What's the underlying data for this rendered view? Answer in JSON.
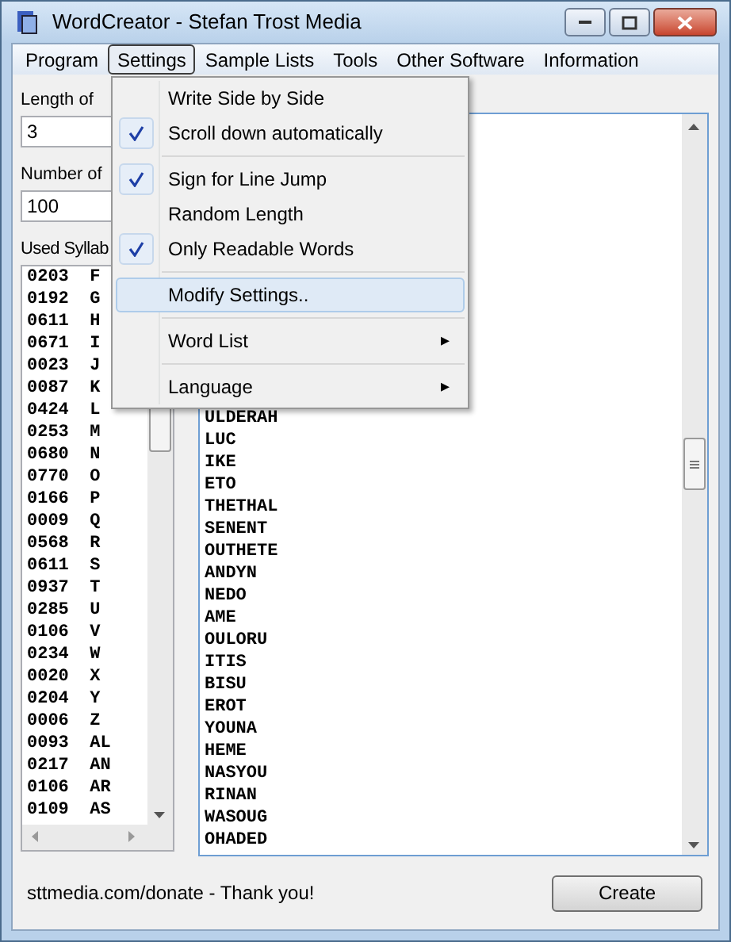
{
  "window": {
    "title": "WordCreator - Stefan Trost Media"
  },
  "menu_bar": [
    {
      "label": "Program",
      "selected": false
    },
    {
      "label": "Settings",
      "selected": true
    },
    {
      "label": "Sample Lists",
      "selected": false
    },
    {
      "label": "Tools",
      "selected": false
    },
    {
      "label": "Other Software",
      "selected": false
    },
    {
      "label": "Information",
      "selected": false
    }
  ],
  "settings_menu": [
    {
      "kind": "item",
      "label": "Write Side by Side",
      "checked": false,
      "selected": false
    },
    {
      "kind": "item",
      "label": "Scroll down automatically",
      "checked": true,
      "selected": false
    },
    {
      "kind": "separator"
    },
    {
      "kind": "item",
      "label": "Sign for Line Jump",
      "checked": true,
      "selected": false
    },
    {
      "kind": "item",
      "label": "Random Length",
      "checked": false,
      "selected": false
    },
    {
      "kind": "item",
      "label": "Only Readable Words",
      "checked": true,
      "selected": false
    },
    {
      "kind": "separator"
    },
    {
      "kind": "item",
      "label": "Modify Settings..",
      "checked": false,
      "selected": true
    },
    {
      "kind": "separator"
    },
    {
      "kind": "submenu",
      "label": "Word List",
      "arrow": "▸"
    },
    {
      "kind": "separator"
    },
    {
      "kind": "submenu",
      "label": "Language",
      "arrow": "▸"
    }
  ],
  "length_label": "Length of",
  "length_value": "3",
  "number_label": "Number of",
  "number_value": "100",
  "syllables_label": "Used Syllab",
  "syllables": [
    "0203  F",
    "0192  G",
    "0611  H",
    "0671  I",
    "0023  J",
    "0087  K",
    "0424  L",
    "0253  M",
    "0680  N",
    "0770  O",
    "0166  P",
    "0009  Q",
    "0568  R",
    "0611  S",
    "0937  T",
    "0285  U",
    "0106  V",
    "0234  W",
    "0020  X",
    "0204  Y",
    "0006  Z",
    "0093  AL",
    "0217  AN",
    "0106  AR",
    "0109  AS"
  ],
  "words": [
    "ULDERAH",
    "LUC",
    "IKE",
    "ETO",
    "THETHAL",
    "SENENT",
    "OUTHETE",
    "ANDYN",
    "NEDO",
    "AME",
    "OULORU",
    "ITIS",
    "BISU",
    "EROT",
    "YOUNA",
    "HEME",
    "NASYOU",
    "RINAN",
    "WASOUG",
    "OHADED"
  ],
  "status_text": "sttmedia.com/donate - Thank you!",
  "create_button": "Create"
}
